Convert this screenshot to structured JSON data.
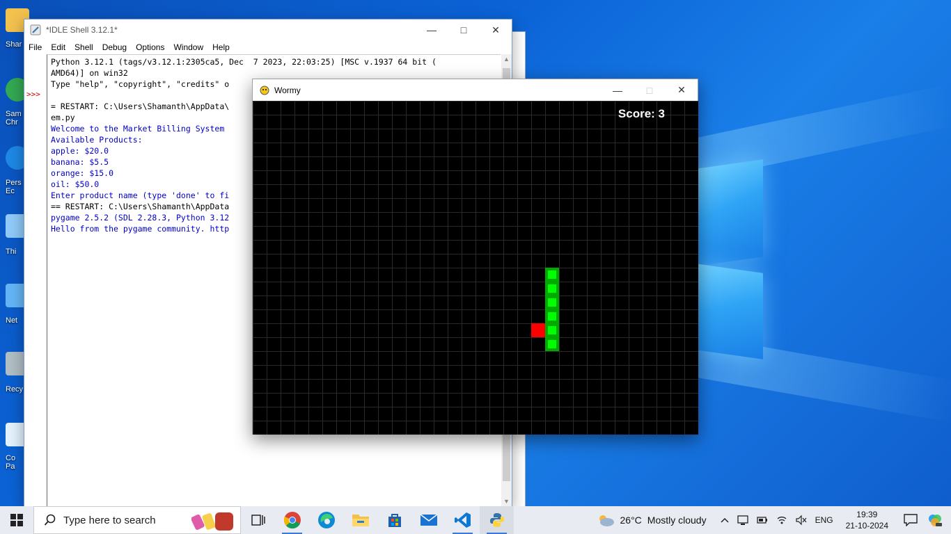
{
  "desktop": {
    "icons": [
      {
        "label": "Shar",
        "color": "#f2c14e"
      },
      {
        "label": "Sam\nChr",
        "color": "#34a853"
      },
      {
        "label": "Pers\nEc",
        "color": "#1e88e5"
      },
      {
        "label": "Thi",
        "color": "#90caf9"
      },
      {
        "label": "Net",
        "color": "#64b5f6"
      },
      {
        "label": "Recy",
        "color": "#b0bec5"
      },
      {
        "label": "Co\nPa",
        "color": "#e3f2fd"
      }
    ]
  },
  "idle": {
    "title": "*IDLE Shell 3.12.1*",
    "menu": [
      "File",
      "Edit",
      "Shell",
      "Debug",
      "Options",
      "Window",
      "Help"
    ],
    "prompt": ">>>",
    "lines": [
      {
        "text": "Python 3.12.1 (tags/v3.12.1:2305ca5, Dec  7 2023, 22:03:25) [MSC v.1937 64 bit (",
        "color": "black"
      },
      {
        "text": "AMD64)] on win32",
        "color": "black"
      },
      {
        "text": "Type \"help\", \"copyright\", \"credits\" o",
        "color": "black"
      },
      {
        "text": "",
        "color": "black"
      },
      {
        "text": "= RESTART: C:\\Users\\Shamanth\\AppData\\",
        "color": "black"
      },
      {
        "text": "em.py",
        "color": "black"
      },
      {
        "text": "Welcome to the Market Billing System",
        "color": "blue"
      },
      {
        "text": "Available Products:",
        "color": "blue"
      },
      {
        "text": "apple: $20.0",
        "color": "blue"
      },
      {
        "text": "banana: $5.5",
        "color": "blue"
      },
      {
        "text": "orange: $15.0",
        "color": "blue"
      },
      {
        "text": "oil: $50.0",
        "color": "blue"
      },
      {
        "text": "Enter product name (type 'done' to fi",
        "color": "blue"
      },
      {
        "text": "== RESTART: C:\\Users\\Shamanth\\AppData",
        "color": "black"
      },
      {
        "text": "pygame 2.5.2 (SDL 2.28.3, Python 3.12",
        "color": "blue"
      },
      {
        "text": "Hello from the pygame community. http",
        "color": "blue"
      }
    ]
  },
  "wormy": {
    "title": "Wormy",
    "score_text": "Score: 3",
    "grid_cols": 32,
    "grid_rows": 24,
    "worm": [
      {
        "col": 21,
        "row": 12
      },
      {
        "col": 21,
        "row": 13
      },
      {
        "col": 21,
        "row": 14
      },
      {
        "col": 21,
        "row": 15
      },
      {
        "col": 21,
        "row": 16
      },
      {
        "col": 21,
        "row": 17
      }
    ],
    "apple": {
      "col": 20,
      "row": 16
    },
    "colors": {
      "worm_outer": "#00aa00",
      "worm_inner": "#00ff00",
      "apple": "#ff0000",
      "grid": "#2a2a2a",
      "background": "#000000"
    }
  },
  "taskbar": {
    "search_placeholder": "Type here to search",
    "apps": [
      "task-view-icon",
      "chrome-icon",
      "edge-icon",
      "file-explorer-icon",
      "store-icon",
      "mail-icon",
      "vscode-icon",
      "python-icon"
    ],
    "weather": {
      "temp": "26°C",
      "condition": "Mostly cloudy"
    },
    "language": "ENG",
    "time": "19:39",
    "date": "21-10-2024"
  }
}
